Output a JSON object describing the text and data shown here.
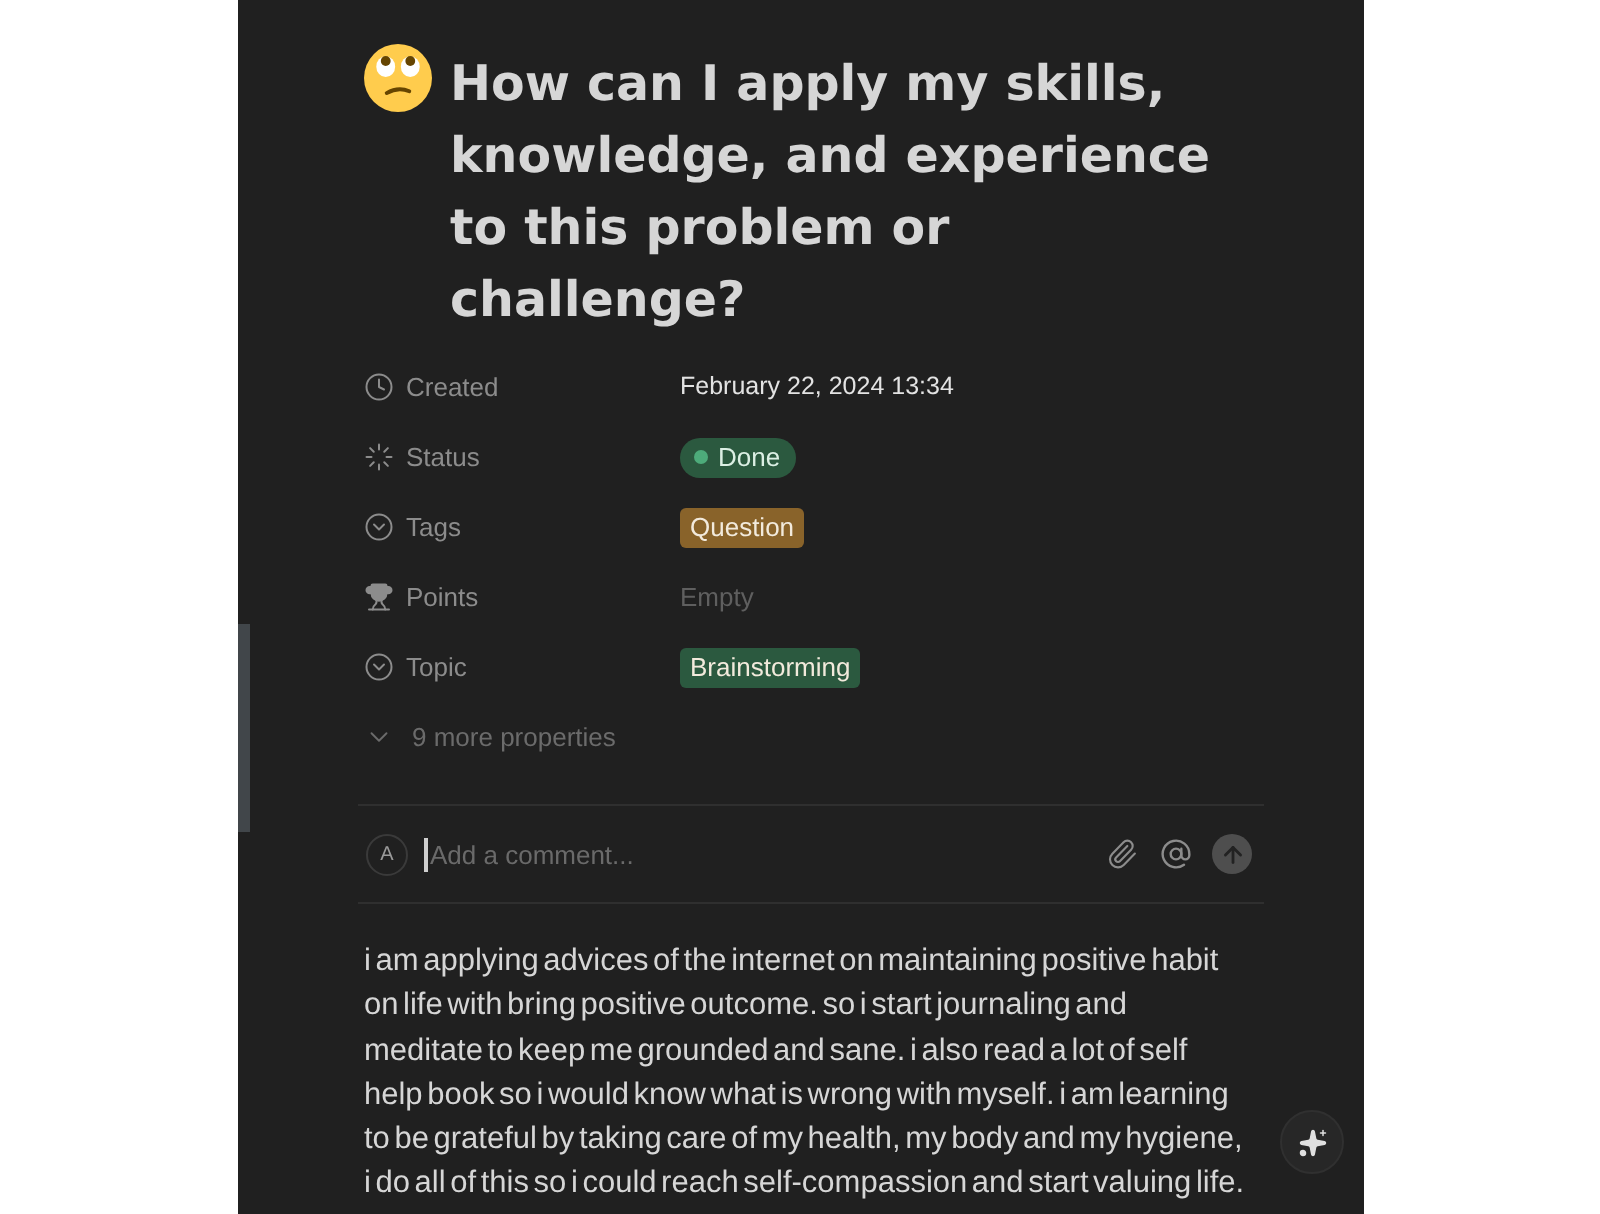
{
  "page": {
    "title": "How can I apply my skills, knowledge, and experience to this problem or challenge?"
  },
  "properties": [
    {
      "kind": "date",
      "label": "Created",
      "value": "February 22, 2024 13:34"
    },
    {
      "kind": "status",
      "label": "Status",
      "value": "Done",
      "color": "#2b593f"
    },
    {
      "kind": "select",
      "label": "Tags",
      "value": "Question",
      "color": "#89632a"
    },
    {
      "kind": "number",
      "label": "Points",
      "placeholder": "Empty"
    },
    {
      "kind": "select",
      "label": "Topic",
      "value": "Brainstorming",
      "color": "#2b593f"
    }
  ],
  "more_properties": {
    "label": "9 more properties",
    "expanded": false
  },
  "comment": {
    "avatar": "A",
    "placeholder": "Add a comment...",
    "focused": true
  },
  "body": "i am applying advices of the internet on maintaining positive habit on life with bring positive outcome. so i start journaling and meditate to keep me grounded and sane. i also read a lot of self help book so i would know what is wrong with myself. i am learning to be grateful by taking care of my health, my body and my hygiene, i do all of this so i could reach self-compassion and start valuing life."
}
